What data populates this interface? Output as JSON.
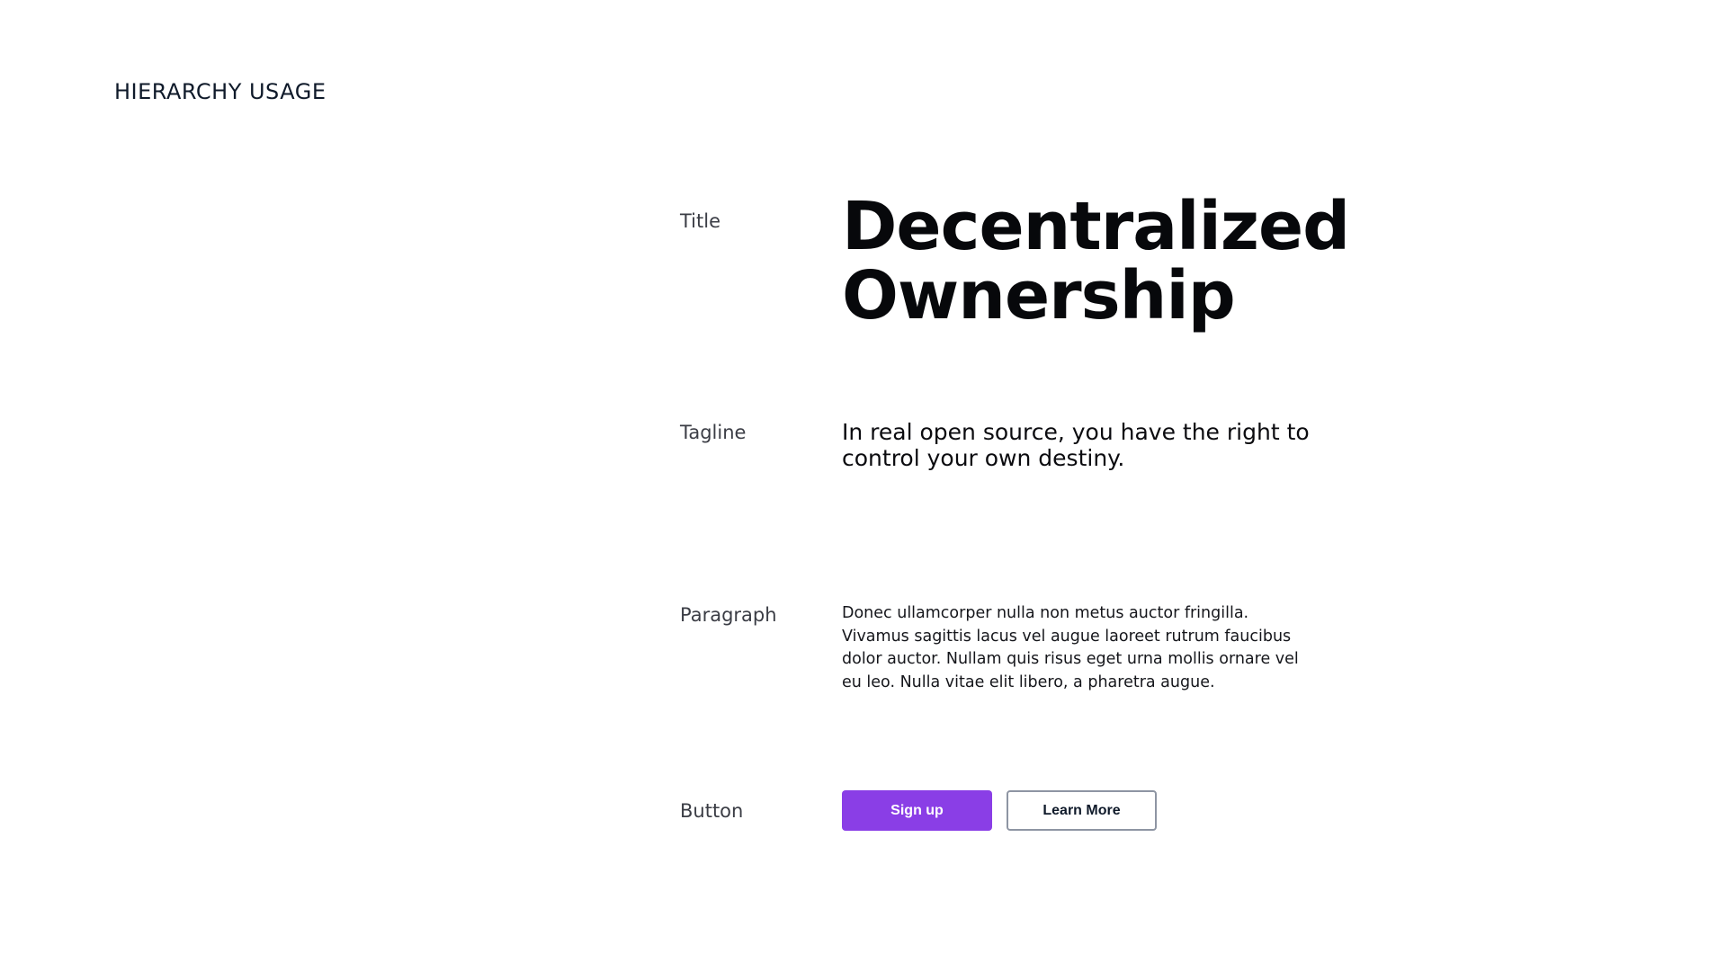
{
  "page": {
    "heading": "HIERARCHY USAGE"
  },
  "rows": {
    "title": {
      "label": "Title",
      "text": "Decentralized Ownership"
    },
    "tagline": {
      "label": "Tagline",
      "text": "In real open source, you have the right to control your own destiny."
    },
    "paragraph": {
      "label": "Paragraph",
      "text": "Donec ullamcorper nulla non metus auctor fringilla. Vivamus sagittis lacus vel augue laoreet rutrum faucibus dolor auctor. Nullam quis risus eget urna mollis ornare vel eu leo. Nulla vitae elit libero, a pharetra augue."
    },
    "button": {
      "label": "Button",
      "primary_label": "Sign up",
      "secondary_label": "Learn More"
    }
  },
  "colors": {
    "primary_button": "#8a3ee6",
    "secondary_border": "#8e95a3",
    "heading_text": "#0f1a2a"
  }
}
